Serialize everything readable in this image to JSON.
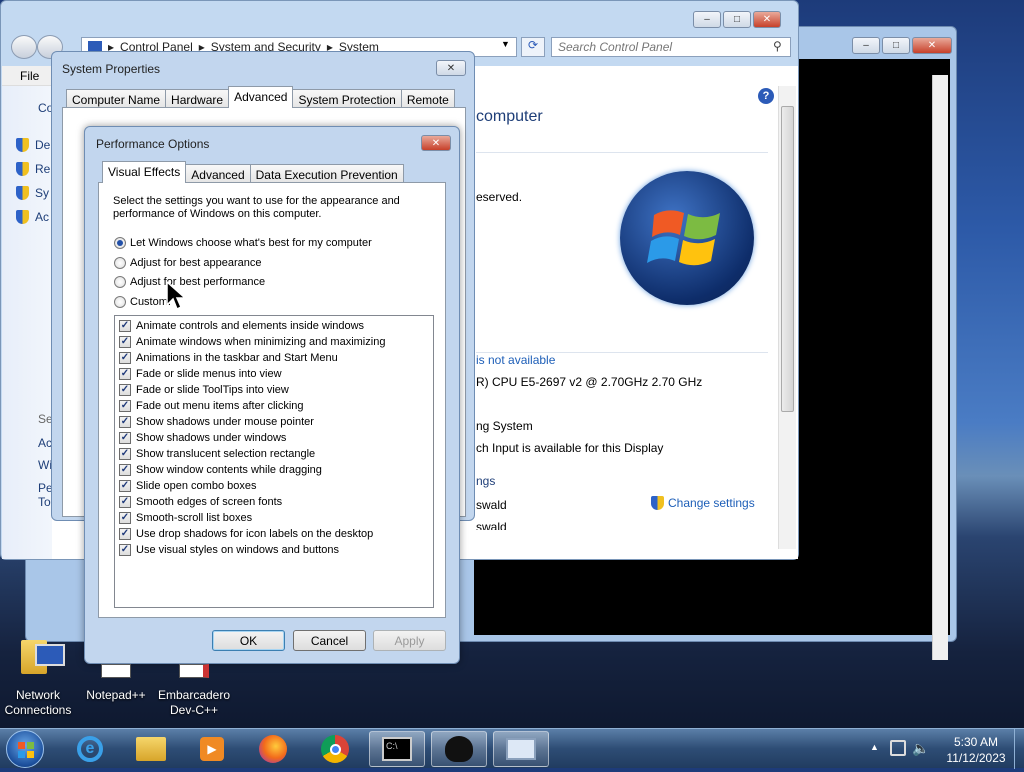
{
  "control_panel": {
    "breadcrumb": [
      "Control Panel",
      "System and Security",
      "System"
    ],
    "search_placeholder": "Search Control Panel",
    "menu_file": "File",
    "left_items": [
      "Co",
      "De",
      "Re",
      "Sy",
      "Ac",
      "Se",
      "Ac",
      "Wi",
      "Pe",
      "To"
    ],
    "content": {
      "heading": "computer",
      "reserved": "eserved.",
      "not_available": "is not available",
      "cpu": "R) CPU E5-2697 v2 @ 2.70GHz   2.70 GHz",
      "os": "ng System",
      "touch": "ch Input is available for this Display",
      "settings": "ngs",
      "wald1": "swald",
      "wald2": "swald",
      "change_settings": "Change settings"
    }
  },
  "system_properties": {
    "title": "System Properties",
    "tabs": [
      "Computer Name",
      "Hardware",
      "Advanced",
      "System Protection",
      "Remote"
    ],
    "selected_tab": "Advanced"
  },
  "performance_options": {
    "title": "Performance Options",
    "tabs": [
      "Visual Effects",
      "Advanced",
      "Data Execution Prevention"
    ],
    "selected_tab": "Visual Effects",
    "description": "Select the settings you want to use for the appearance and performance of Windows on this computer.",
    "radios": [
      {
        "label": "Let Windows choose what's best for my computer",
        "checked": true
      },
      {
        "label": "Adjust for best appearance",
        "checked": false
      },
      {
        "label": "Adjust for best performance",
        "checked": false
      },
      {
        "label": "Custom:",
        "checked": false
      }
    ],
    "effects": [
      "Animate controls and elements inside windows",
      "Animate windows when minimizing and maximizing",
      "Animations in the taskbar and Start Menu",
      "Fade or slide menus into view",
      "Fade or slide ToolTips into view",
      "Fade out menu items after clicking",
      "Show shadows under mouse pointer",
      "Show shadows under windows",
      "Show translucent selection rectangle",
      "Show window contents while dragging",
      "Slide open combo boxes",
      "Smooth edges of screen fonts",
      "Smooth-scroll list boxes",
      "Use drop shadows for icon labels on the desktop",
      "Use visual styles on windows and buttons"
    ],
    "ok": "OK",
    "cancel": "Cancel",
    "apply": "Apply"
  },
  "desktop_icons": [
    {
      "label": "Network Connections"
    },
    {
      "label": "Notepad++"
    },
    {
      "label": "Embarcadero Dev-C++"
    }
  ],
  "clock": {
    "time": "5:30 AM",
    "date": "11/12/2023"
  }
}
